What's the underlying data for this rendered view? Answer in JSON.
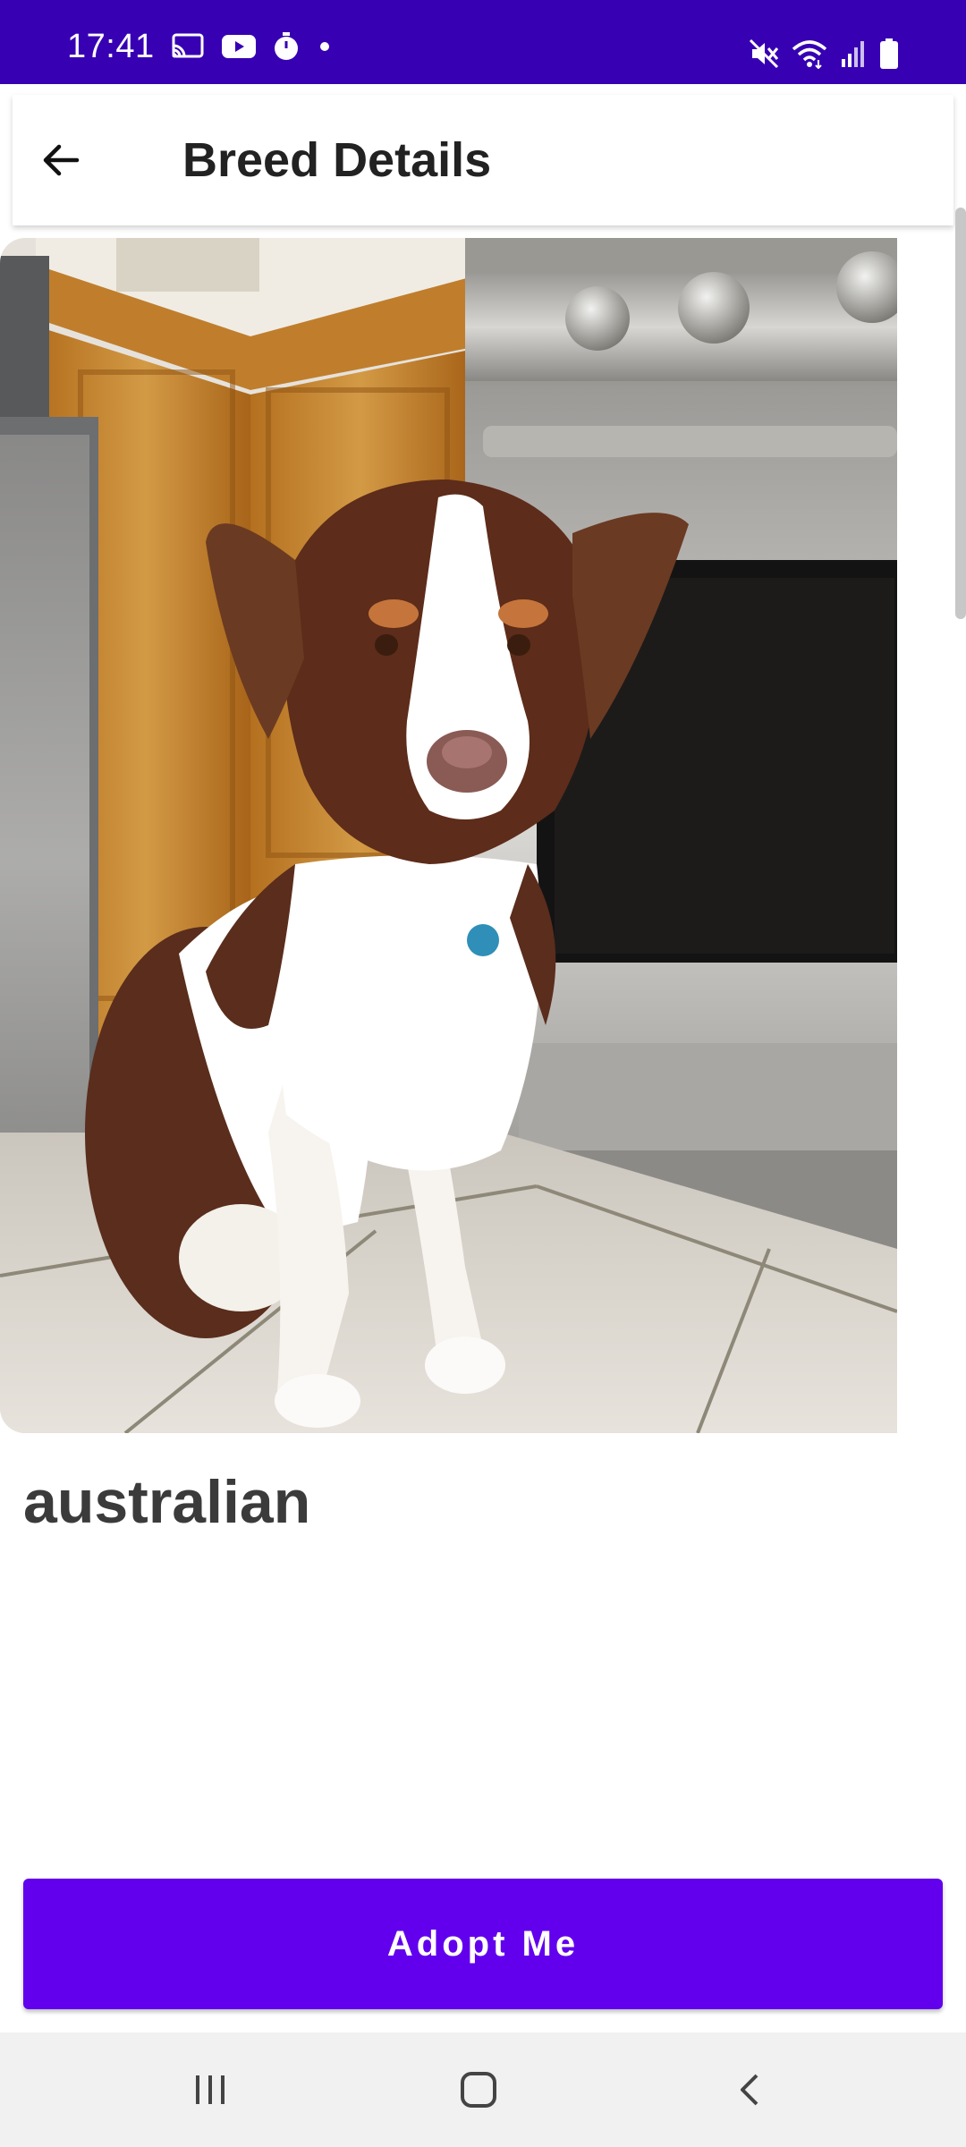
{
  "status_bar": {
    "time": "17:41",
    "background": "#3700b3",
    "left_icons": [
      "cast-icon",
      "youtube-icon",
      "timer-icon",
      "dot-icon"
    ],
    "right_icons": [
      "mute-icon",
      "wifi-icon",
      "signal-icon",
      "battery-icon"
    ]
  },
  "app_bar": {
    "title": "Breed Details",
    "back_icon": "arrow-back-icon"
  },
  "breed": {
    "name": "australian"
  },
  "adopt_button": {
    "label": "Adopt Me",
    "color": "#6200ee"
  },
  "nav_bar": {
    "buttons": [
      "recents-icon",
      "home-icon",
      "back-icon"
    ]
  }
}
